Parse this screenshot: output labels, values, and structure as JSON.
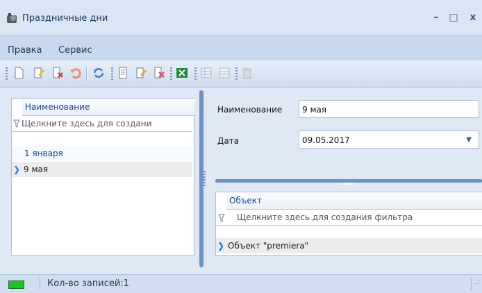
{
  "window": {
    "title": "Праздничные дни",
    "minimize": "–",
    "maximize": "□",
    "close": "x"
  },
  "menu": [
    "Правка",
    "Сервис"
  ],
  "left_grid": {
    "header": "Наименование",
    "filter_text": "Щелкните здесь для создани",
    "rows": [
      "1 января",
      "9 мая"
    ],
    "selected_row": "9 мая"
  },
  "form": {
    "name_label": "Наименование",
    "name_value": "9 мая",
    "date_label": "Дата",
    "date_value": "09.05.2017"
  },
  "right_grid": {
    "header": "Объект",
    "filter_text": "Щелкните здесь для создания фильтра",
    "rows": [
      "Объект \"premiera\""
    ]
  },
  "status": {
    "text": "Кол-во записей:1"
  },
  "colors": {
    "accent": "#6c93c4",
    "status_led": "#1fbf2d"
  }
}
